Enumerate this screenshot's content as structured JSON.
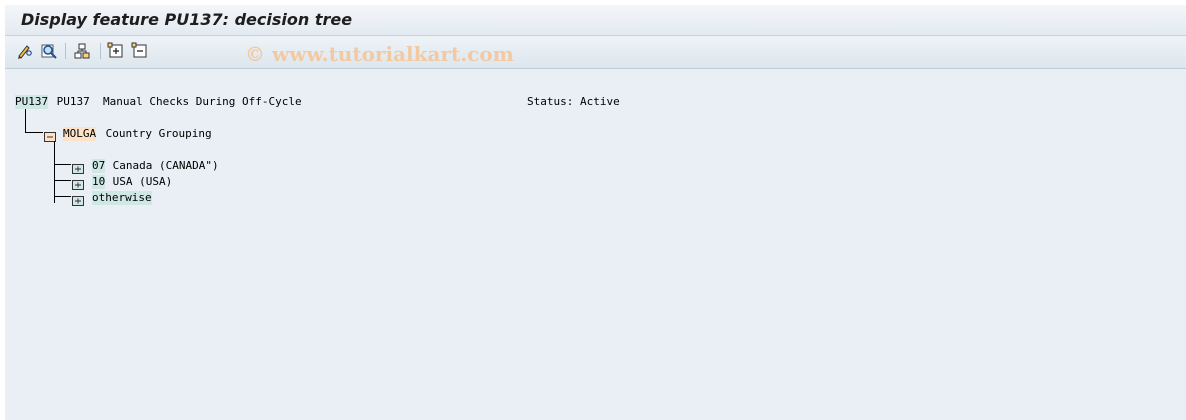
{
  "window": {
    "title": "Display feature PU137: decision tree"
  },
  "watermark": "© www.tutorialkart.com",
  "toolbar": {
    "buttons": [
      {
        "name": "edit-icon",
        "tooltip": ""
      },
      {
        "name": "find-icon",
        "tooltip": ""
      },
      {
        "name": "hierarchy-icon",
        "tooltip": ""
      },
      {
        "name": "expand-icon",
        "tooltip": ""
      },
      {
        "name": "collapse-icon",
        "tooltip": ""
      }
    ]
  },
  "tree": {
    "root": {
      "key": "PU137",
      "text": " PU137  Manual Checks During Off-Cycle",
      "status": "Status: Active"
    },
    "level1": {
      "key": "MOLGA",
      "text": " Country Grouping"
    },
    "children": [
      {
        "key": "07",
        "text": " Canada (CANADA\")"
      },
      {
        "key": "10",
        "text": " USA (USA)"
      },
      {
        "key": "otherwise",
        "text": ""
      }
    ]
  },
  "colors": {
    "background": "#e9eff5",
    "key_highlight": "#cfe8e6",
    "folder_highlight": "#fde2c8"
  }
}
